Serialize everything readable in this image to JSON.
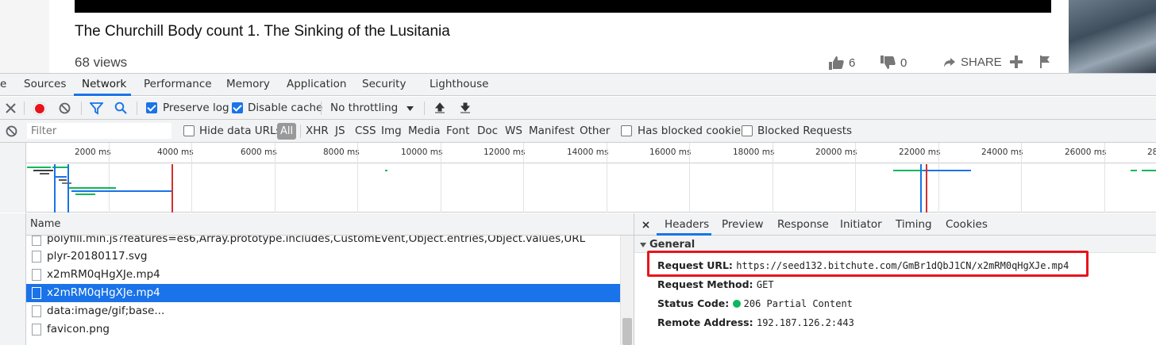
{
  "video": {
    "title": "The Churchill Body count 1. The Sinking of the Lusitania",
    "views": "68 views",
    "likes": "6",
    "dislikes": "0",
    "share_label": "SHARE"
  },
  "devtools": {
    "tabs": [
      {
        "label": "e"
      },
      {
        "label": "Sources"
      },
      {
        "label": "Network"
      },
      {
        "label": "Performance"
      },
      {
        "label": "Memory"
      },
      {
        "label": "Application"
      },
      {
        "label": "Security"
      },
      {
        "label": "Lighthouse"
      }
    ],
    "active_tab": "Network",
    "toolbar": {
      "preserve_log": "Preserve log",
      "disable_cache": "Disable cache",
      "throttling": "No throttling"
    },
    "filter_bar": {
      "placeholder": "Filter",
      "hide_data_urls": "Hide data URLs",
      "all": "All",
      "types": [
        "XHR",
        "JS",
        "CSS",
        "Img",
        "Media",
        "Font",
        "Doc",
        "WS",
        "Manifest",
        "Other"
      ],
      "has_blocked_cookies": "Has blocked cookies",
      "blocked_requests": "Blocked Requests"
    },
    "timeline": {
      "ticks": [
        "2000 ms",
        "4000 ms",
        "6000 ms",
        "8000 ms",
        "10000 ms",
        "12000 ms",
        "14000 ms",
        "16000 ms",
        "18000 ms",
        "20000 ms",
        "22000 ms",
        "24000 ms",
        "26000 ms",
        "28"
      ]
    },
    "requests": {
      "header": "Name",
      "rows": [
        {
          "name": "polyfill.min.js?features=es6,Array.prototype.includes,CustomEvent,Object.entries,Object.values,URL"
        },
        {
          "name": "plyr-20180117.svg"
        },
        {
          "name": "x2mRM0qHgXJe.mp4"
        },
        {
          "name": "x2mRM0qHgXJe.mp4"
        },
        {
          "name": "data:image/gif;base..."
        },
        {
          "name": "favicon.png"
        }
      ],
      "selected_index": 3
    },
    "details": {
      "tabs": [
        "Headers",
        "Preview",
        "Response",
        "Initiator",
        "Timing",
        "Cookies"
      ],
      "active_tab": "Headers",
      "section": "General",
      "general": {
        "request_url_label": "Request URL:",
        "request_url": "https://seed132.bitchute.com/GmBr1dQbJ1CN/x2mRM0qHgXJe.mp4",
        "request_method_label": "Request Method:",
        "request_method": "GET",
        "status_code_label": "Status Code:",
        "status_code": "206 Partial Content",
        "remote_address_label": "Remote Address:",
        "remote_address": "192.187.126.2:443"
      }
    },
    "colors": {
      "accent": "#1a73e8",
      "record": "#e8141d",
      "highlight_box": "#e8141d",
      "status_ok": "#0cb85b"
    }
  }
}
